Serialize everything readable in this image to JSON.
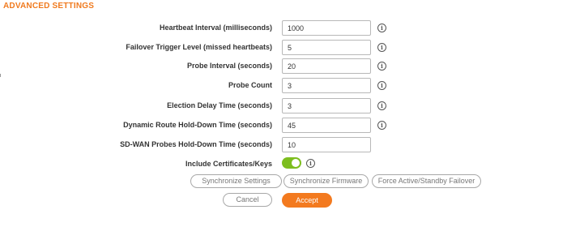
{
  "section": {
    "title": "ADVANCED SETTINGS"
  },
  "fields": [
    {
      "label": "Heartbeat Interval (milliseconds)",
      "value": "1000"
    },
    {
      "label": "Failover Trigger Level (missed heartbeats)",
      "value": "5"
    },
    {
      "label": "Probe Interval (seconds)",
      "value": "20"
    },
    {
      "label": "Probe Count",
      "value": "3"
    },
    {
      "label": "Election Delay Time (seconds)",
      "value": "3"
    },
    {
      "label": "Dynamic Route Hold-Down Time (seconds)",
      "value": "45"
    },
    {
      "label": "SD-WAN Probes Hold-Down Time (seconds)",
      "value": "10"
    }
  ],
  "include_certs": {
    "label": "Include Certificates/Keys",
    "enabled": true
  },
  "info_glyph": "i",
  "buttons": {
    "sync_settings": "Synchronize Settings",
    "sync_firmware": "Synchronize Firmware",
    "force_failover": "Force Active/Standby Failover",
    "cancel": "Cancel",
    "accept": "Accept"
  },
  "colors": {
    "accent": "#f37a1f",
    "toggle_on": "#7dbe1f"
  },
  "icons": {
    "info": "info-circle-icon"
  }
}
